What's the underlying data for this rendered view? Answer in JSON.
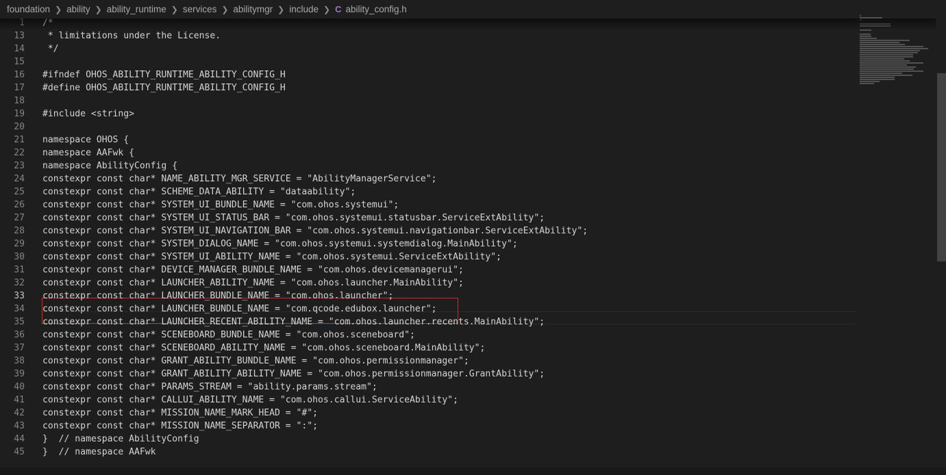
{
  "breadcrumb": {
    "segments": [
      "foundation",
      "ability",
      "ability_runtime",
      "services",
      "abilitymgr",
      "include"
    ],
    "file_icon": "C",
    "file_name": "ability_config.h"
  },
  "editor": {
    "active_line": "33",
    "lines": [
      {
        "n": "1",
        "text": "/*"
      },
      {
        "n": "13",
        "text": " * limitations under the License."
      },
      {
        "n": "14",
        "text": " */"
      },
      {
        "n": "15",
        "text": ""
      },
      {
        "n": "16",
        "text": "#ifndef OHOS_ABILITY_RUNTIME_ABILITY_CONFIG_H"
      },
      {
        "n": "17",
        "text": "#define OHOS_ABILITY_RUNTIME_ABILITY_CONFIG_H"
      },
      {
        "n": "18",
        "text": ""
      },
      {
        "n": "19",
        "text": "#include <string>"
      },
      {
        "n": "20",
        "text": ""
      },
      {
        "n": "21",
        "text": "namespace OHOS {"
      },
      {
        "n": "22",
        "text": "namespace AAFwk {"
      },
      {
        "n": "23",
        "text": "namespace AbilityConfig {"
      },
      {
        "n": "24",
        "text": "constexpr const char* NAME_ABILITY_MGR_SERVICE = \"AbilityManagerService\";"
      },
      {
        "n": "25",
        "text": "constexpr const char* SCHEME_DATA_ABILITY = \"dataability\";"
      },
      {
        "n": "26",
        "text": "constexpr const char* SYSTEM_UI_BUNDLE_NAME = \"com.ohos.systemui\";"
      },
      {
        "n": "27",
        "text": "constexpr const char* SYSTEM_UI_STATUS_BAR = \"com.ohos.systemui.statusbar.ServiceExtAbility\";"
      },
      {
        "n": "28",
        "text": "constexpr const char* SYSTEM_UI_NAVIGATION_BAR = \"com.ohos.systemui.navigationbar.ServiceExtAbility\";"
      },
      {
        "n": "29",
        "text": "constexpr const char* SYSTEM_DIALOG_NAME = \"com.ohos.systemui.systemdialog.MainAbility\";"
      },
      {
        "n": "30",
        "text": "constexpr const char* SYSTEM_UI_ABILITY_NAME = \"com.ohos.systemui.ServiceExtAbility\";"
      },
      {
        "n": "31",
        "text": "constexpr const char* DEVICE_MANAGER_BUNDLE_NAME = \"com.ohos.devicemanagerui\";"
      },
      {
        "n": "32",
        "text": "constexpr const char* LAUNCHER_ABILITY_NAME = \"com.ohos.launcher.MainAbility\";"
      },
      {
        "n": "33",
        "text": "constexpr const char* LAUNCHER_BUNDLE_NAME = \"com.ohos.launcher\";"
      },
      {
        "n": "34",
        "text": "constexpr const char* LAUNCHER_BUNDLE_NAME = \"com.qcode.edubox.launcher\";"
      },
      {
        "n": "35",
        "text": "constexpr const char* LAUNCHER_RECENT_ABILITY_NAME = \"com.ohos.launcher.recents.MainAbility\";"
      },
      {
        "n": "36",
        "text": "constexpr const char* SCENEBOARD_BUNDLE_NAME = \"com.ohos.sceneboard\";"
      },
      {
        "n": "37",
        "text": "constexpr const char* SCENEBOARD_ABILITY_NAME = \"com.ohos.sceneboard.MainAbility\";"
      },
      {
        "n": "38",
        "text": "constexpr const char* GRANT_ABILITY_BUNDLE_NAME = \"com.ohos.permissionmanager\";"
      },
      {
        "n": "39",
        "text": "constexpr const char* GRANT_ABILITY_ABILITY_NAME = \"com.ohos.permissionmanager.GrantAbility\";"
      },
      {
        "n": "40",
        "text": "constexpr const char* PARAMS_STREAM = \"ability.params.stream\";"
      },
      {
        "n": "41",
        "text": "constexpr const char* CALLUI_ABILITY_NAME = \"com.ohos.callui.ServiceAbility\";"
      },
      {
        "n": "42",
        "text": "constexpr const char* MISSION_NAME_MARK_HEAD = \"#\";"
      },
      {
        "n": "43",
        "text": "constexpr const char* MISSION_NAME_SEPARATOR = \":\";"
      },
      {
        "n": "44",
        "text": "}  // namespace AbilityConfig"
      },
      {
        "n": "45",
        "text": "}  // namespace AAFwk"
      }
    ]
  },
  "colors": {
    "background": "#1e1e1e",
    "text": "#d4d4d4",
    "line_number": "#858585",
    "highlight_box": "#d12a2a",
    "c_file_icon": "#a074c4"
  }
}
